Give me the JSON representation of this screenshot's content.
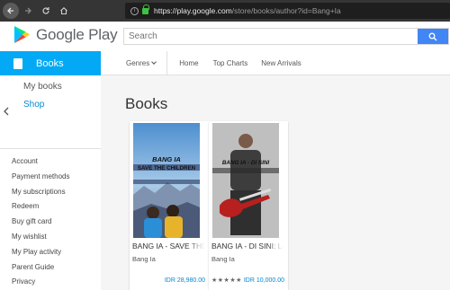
{
  "browser": {
    "url_host": "https://play.google.com",
    "url_path": "/store/books/author?id=Bang+Ia"
  },
  "header": {
    "logo_text": "Google Play",
    "search_placeholder": "Search"
  },
  "nav": {
    "category": "Books",
    "genres": "Genres",
    "links": [
      "Home",
      "Top Charts",
      "New Arrivals"
    ]
  },
  "sidebar": {
    "my_books": "My books",
    "shop": "Shop",
    "links": [
      "Account",
      "Payment methods",
      "My subscriptions",
      "Redeem",
      "Buy gift card",
      "My wishlist",
      "My Play activity",
      "Parent Guide",
      "Privacy"
    ]
  },
  "main": {
    "title": "Books",
    "cards": [
      {
        "title": "BANG IA - SAVE THE CHILDREN",
        "author": "Bang Ia",
        "price": "IDR 28,980.00",
        "cover_title": "BANG IA",
        "cover_subtitle": "SAVE THE CHILDREN"
      },
      {
        "title": "BANG IA - DI SINI: Lagu",
        "author": "Bang Ia",
        "price": "IDR 10,000.00",
        "stars": "★★★★★",
        "cover_title": "BANG IA - DI SINI"
      }
    ]
  },
  "colors": {
    "accent": "#03a9f4",
    "search_button": "#4285f4",
    "price": "#0288d1",
    "shop_link": "#0288d1"
  }
}
